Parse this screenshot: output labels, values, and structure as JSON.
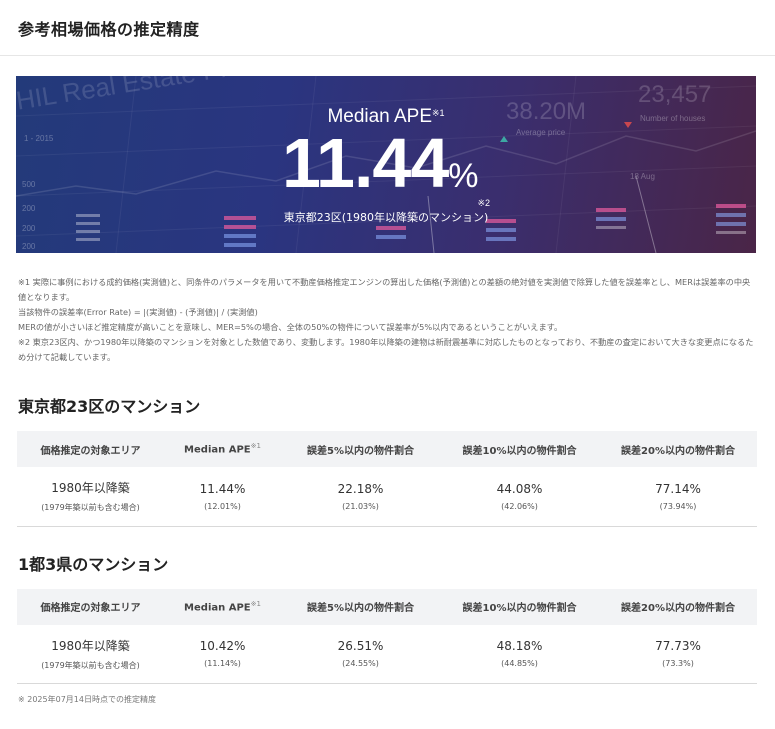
{
  "page": {
    "title": "参考相場価格の推定精度"
  },
  "hero": {
    "watermark_title": "HIL Real Estate Price Engine",
    "watermark_average": "38.20M",
    "watermark_average_label": "Average price",
    "watermark_count": "23,457",
    "watermark_count_label": "Number of houses",
    "watermark_date": "18 Aug",
    "watermark_year": "1 - 2015",
    "watermark_axis": [
      "500",
      "200",
      "200",
      "200"
    ],
    "label": "Median APE",
    "label_note": "※1",
    "value": "11.44",
    "unit": "%",
    "value_note": "※2",
    "scope": "東京都23区(1980年以降築のマンション)"
  },
  "notes": [
    "※1 実際に事例における成約価格(実測値)と、同条件のパラメータを用いて不動産価格推定エンジンの算出した価格(予測値)との差額の絶対値を実測値で除算した値を誤差率とし、MERは誤差率の中央値となります。",
    "当該物件の誤差率(Error Rate) = |(実測値) - (予測値)| / (実測値)",
    "MERの値が小さいほど推定精度が高いことを意味し、MER=5%の場合、全体の50%の物件について誤差率が5%以内であるということがいえます。",
    "※2 東京23区内、かつ1980年以降築のマンションを対象とした数値であり、変動します。1980年以降築の建物は新耐震基準に対応したものとなっており、不動産の査定において大きな変更点になるため分けて記載しています。"
  ],
  "table_headers": {
    "area": "価格推定の対象エリア",
    "median": "Median APE",
    "median_note": "※1",
    "within5": "誤差5%以内の物件割合",
    "within10": "誤差10%以内の物件割合",
    "within20": "誤差20%以内の物件割合"
  },
  "tokyo23": {
    "title": "東京都23区のマンション",
    "row": {
      "area": "1980年以降築",
      "area_sub": "(1979年築以前も含む場合)",
      "median": "11.44%",
      "median_sub": "(12.01%)",
      "within5": "22.18%",
      "within5_sub": "(21.03%)",
      "within10": "44.08%",
      "within10_sub": "(42.06%)",
      "within20": "77.14%",
      "within20_sub": "(73.94%)"
    }
  },
  "metro": {
    "title": "1都3県のマンション",
    "row": {
      "area": "1980年以降築",
      "area_sub": "(1979年築以前も含む場合)",
      "median": "10.42%",
      "median_sub": "(11.14%)",
      "within5": "26.51%",
      "within5_sub": "(24.55%)",
      "within10": "48.18%",
      "within10_sub": "(44.85%)",
      "within20": "77.73%",
      "within20_sub": "(73.3%)"
    }
  },
  "footnote": "※ 2025年07月14日時点での推定精度"
}
